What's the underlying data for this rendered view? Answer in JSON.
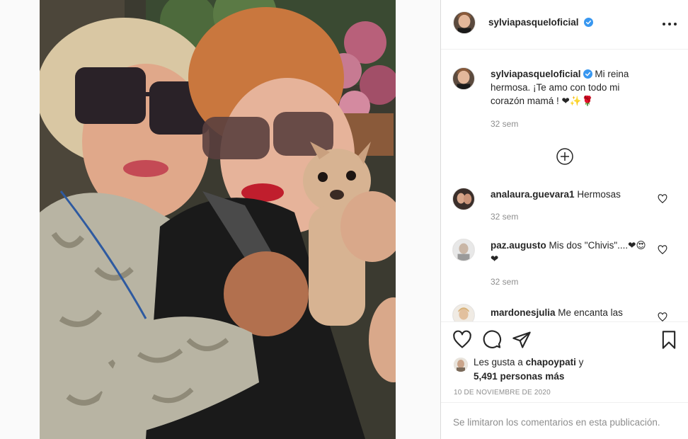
{
  "post": {
    "username": "sylviapasqueloficial",
    "more_icon": "more-horizontal-icon",
    "verified_color": "#3897f0"
  },
  "comments": [
    {
      "username": "sylviapasqueloficial",
      "text": "Mi reina hermosa. ¡Te amo con todo mi corazón mamá ! ❤✨🌹",
      "time": "32 sem",
      "verified": true
    },
    {
      "username": "analaura.guevara1",
      "text": "Hermosas",
      "time": "32 sem"
    },
    {
      "username": "paz.augusto",
      "text": "Mis dos \"Chivis\"....❤😍❤",
      "time": "32 sem"
    },
    {
      "username": "mardonesjulia",
      "text": "Me encanta las",
      "time": ""
    }
  ],
  "actions": {
    "icons": [
      "heart-icon",
      "comment-icon",
      "share-icon",
      "bookmark-icon"
    ]
  },
  "likes": {
    "prefix": "Les gusta a",
    "user": "chapoypati",
    "joiner": "y",
    "count_text": "5,491 personas más"
  },
  "date": "10 DE NOVIEMBRE DE 2020",
  "footer": {
    "text": "Se limitaron los comentarios en esta publicación."
  },
  "colors": {
    "text": "#262626",
    "muted": "#8e8e8e",
    "border": "#dbdbdb"
  }
}
